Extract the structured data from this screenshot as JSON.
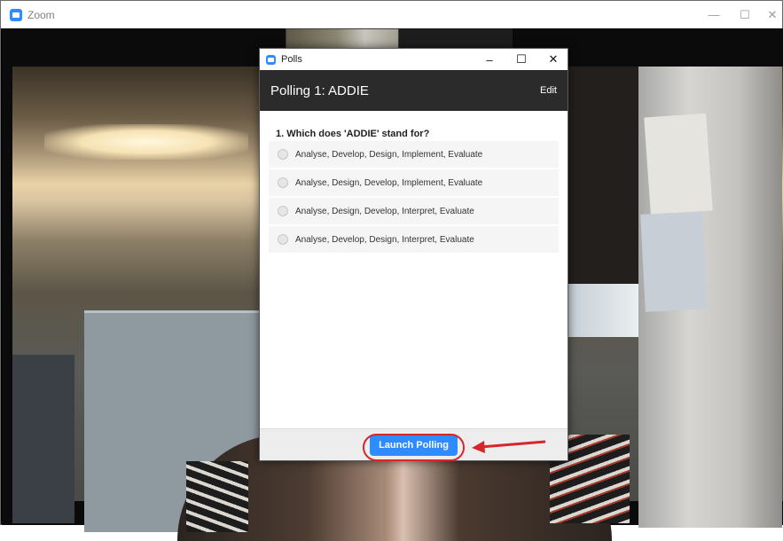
{
  "zoom_window": {
    "title": "Zoom",
    "controls": [
      "minimize-icon",
      "maximize-icon",
      "close-icon"
    ]
  },
  "polls_dialog": {
    "window_title": "Polls",
    "header_title": "Polling 1: ADDIE",
    "edit_label": "Edit",
    "question": "1. Which does 'ADDIE' stand for?",
    "options": [
      "Analyse, Develop, Design, Implement, Evaluate",
      "Analyse, Design, Develop, Implement, Evaluate",
      "Analyse, Design, Develop, Interpret, Evaluate",
      "Analyse, Develop, Design, Interpret, Evaluate"
    ],
    "launch_label": "Launch Polling"
  },
  "colors": {
    "accent": "#2d8cff",
    "header_bg": "#2b2b2b",
    "annotation_red": "#d7262b"
  }
}
